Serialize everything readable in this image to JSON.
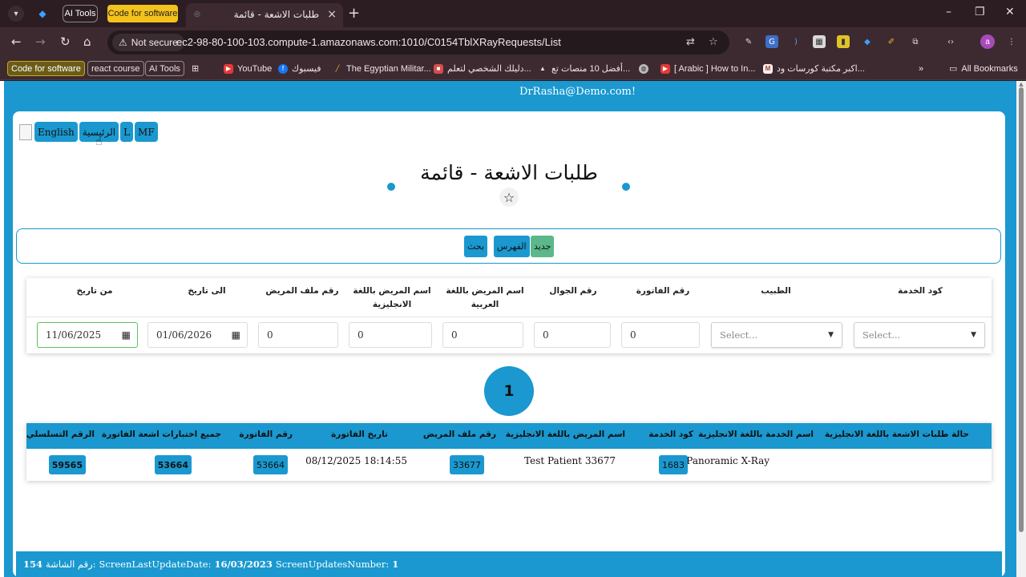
{
  "browser": {
    "pinned_tabs": [
      "AI Tools",
      "Code for software"
    ],
    "active_tab_title": "طلبات الاشعة - قائمة",
    "window_controls": [
      "–",
      "❐",
      "✕"
    ],
    "address": {
      "security_label": "Not secure",
      "url": "ec2-98-80-100-103.compute-1.amazonaws.com:1010/C0154TblXRayRequests/List"
    },
    "profile_initial": "a",
    "bookmarks": [
      "Code for software",
      "react course",
      "AI Tools",
      "YouTube",
      "فيسبوك",
      "The Egyptian Militar...",
      "دليلك الشخصي لتعلم...",
      "أفضل 10 منصات تع...",
      "[ Arabic ] How to In...",
      "اكبر مكتبة كورسات ود...",
      "All Bookmarks"
    ]
  },
  "app": {
    "user_email": "DrRasha@Demo.com!",
    "top_buttons": [
      "English",
      "الرئيسية",
      "L",
      "MF"
    ],
    "page_title": "طلبات الاشعة - قائمة",
    "actions": {
      "search": "بحث",
      "index": "الفهرس",
      "new": "جديد"
    },
    "filters": {
      "labels": {
        "service_code": "كود الخدمة",
        "doctor": "الطبيب",
        "invoice_number": "رقم الفاتورة",
        "mobile": "رقم الجوال",
        "patient_name_ar": "اسم المريض باللغة العربية",
        "patient_name_en": "اسم المريض باللغة الانجليزية",
        "patient_file": "رقم ملف المريض",
        "to_date": "الى تاريخ",
        "from_date": "من تاريخ"
      },
      "values": {
        "service_code": "Select...",
        "doctor": "Select...",
        "invoice_number": "0",
        "mobile": "0",
        "patient_name_ar": "0",
        "patient_name_en": "0",
        "patient_file": "0",
        "to_date": "01/06/2026",
        "from_date": "11/06/2025"
      }
    },
    "current_page": "1",
    "table": {
      "headers": {
        "status": "حالة طلبات الاشعة باللغة الانجليزية",
        "service_name": "اسم الخدمة باللغة الانجليزية",
        "service_code": "كود الخدمة",
        "patient_name": "اسم المريض باللغة الانجليزية",
        "patient_file": "رقم ملف المريض",
        "invoice_date": "تاريخ الفاتورة",
        "invoice_no": "رقم الفاتورة",
        "all_tests": "جميع اختبارات اشعة الفاتورة",
        "serial": "الرقم التسلسلي"
      },
      "rows": [
        {
          "status": "",
          "service_name": "Panoramic X-Ray",
          "service_code": "1683",
          "patient_name": "Test Patient 33677",
          "patient_file": "33677",
          "invoice_date": "08/12/2025 18:14:55",
          "invoice_no": "53664",
          "all_tests": "53664",
          "serial": "59565"
        }
      ]
    },
    "footer": {
      "screen_number_value": "154",
      "screen_number_label": "رقم الشاشة:",
      "last_update_label": "ScreenLastUpdateDate:",
      "last_update_value": "16/03/2023",
      "updates_label": "ScreenUpdatesNumber:",
      "updates_value": "1"
    }
  },
  "colors": {
    "primary": "#1a98cf",
    "new_button": "#5cb88a",
    "browser_frame": "#3d2a30"
  }
}
